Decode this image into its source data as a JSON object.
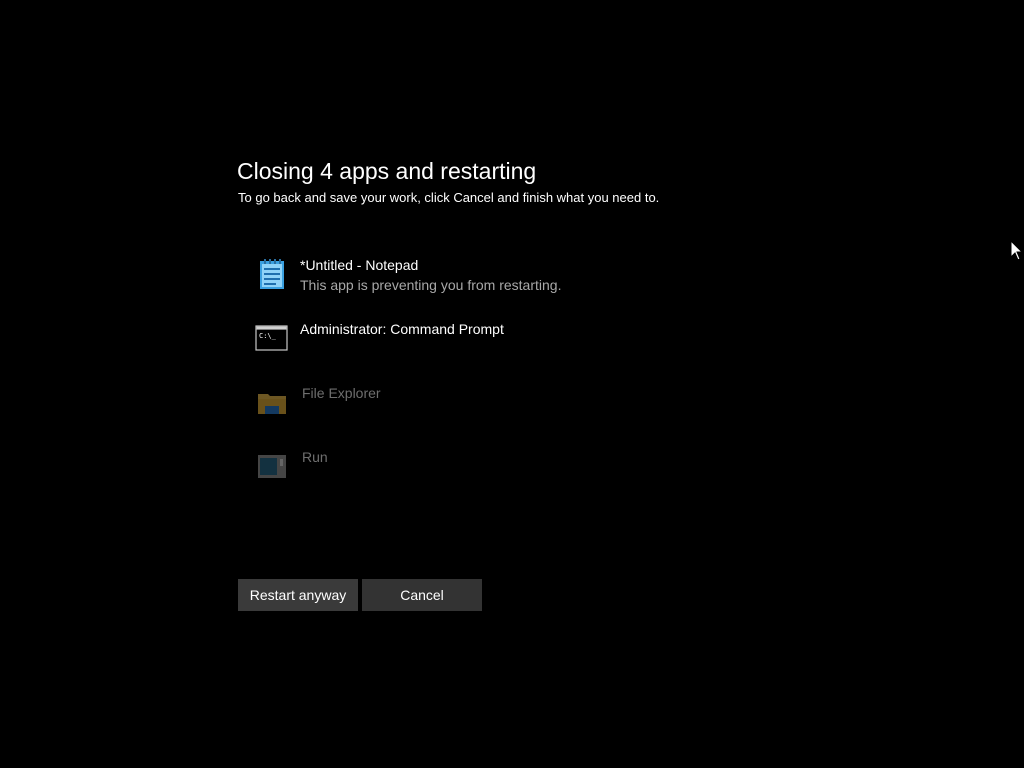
{
  "dialog": {
    "title": "Closing 4 apps and restarting",
    "subtitle": "To go back and save your work, click Cancel and finish what you need to."
  },
  "apps": [
    {
      "name": "*Untitled - Notepad",
      "status": "This app is preventing you from restarting.",
      "icon": "notepad-icon",
      "dimmed": false
    },
    {
      "name": "Administrator: Command Prompt",
      "status": "",
      "icon": "command-prompt-icon",
      "dimmed": false
    },
    {
      "name": "File Explorer",
      "status": "",
      "icon": "file-explorer-icon",
      "dimmed": true
    },
    {
      "name": "Run",
      "status": "",
      "icon": "run-icon",
      "dimmed": true
    }
  ],
  "buttons": {
    "restart_label": "Restart anyway",
    "cancel_label": "Cancel"
  },
  "colors": {
    "background": "#000000",
    "text": "#ffffff",
    "secondary_text": "#a8a8a8",
    "dimmed_text": "#6e6e6e",
    "button_background": "#333333"
  }
}
